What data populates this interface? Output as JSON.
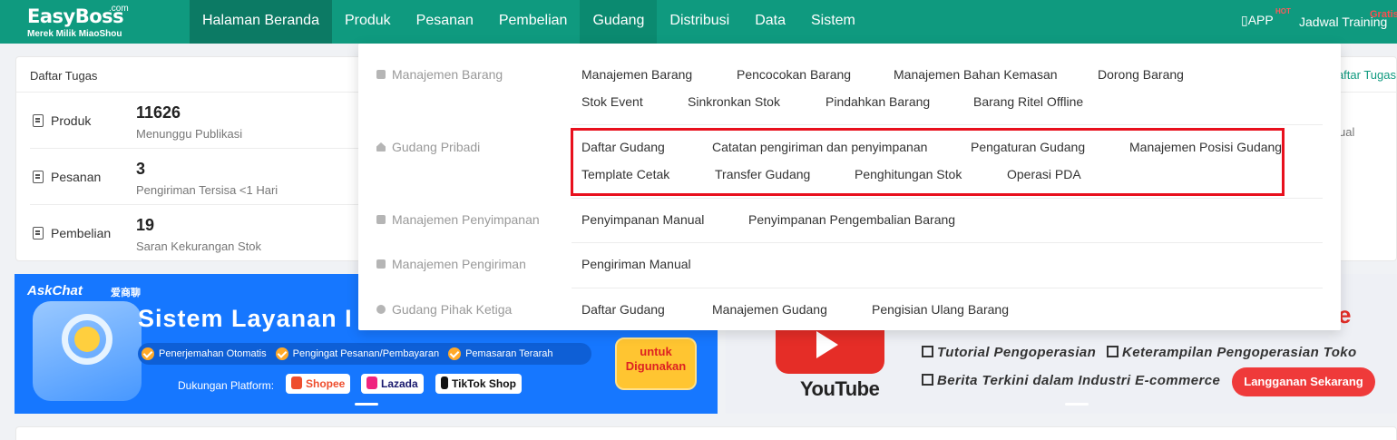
{
  "header": {
    "logo_name": "EasyBoss",
    "logo_com": ".com",
    "logo_tagline": "Merek Milik MiaoShou",
    "nav": [
      "Halaman Beranda",
      "Produk",
      "Pesanan",
      "Pembelian",
      "Gudang",
      "Distribusi",
      "Data",
      "Sistem"
    ],
    "active_nav": "Halaman Beranda",
    "open_nav": "Gudang",
    "app_label": "APP",
    "app_badge": "HOT",
    "training_label": "Jadwal Training",
    "training_badge": "Gratis",
    "accent_color": "#0f9a7f"
  },
  "tasks": {
    "title": "Daftar Tugas",
    "link": "Daftar Tugas",
    "rows": [
      {
        "label": "Produk",
        "count": "11626",
        "desc": "Menunggu Publikasi",
        "icon": "document-icon"
      },
      {
        "label": "Pesanan",
        "count": "3",
        "desc": "Pengiriman Tersisa <1 Hari",
        "icon": "clipboard-icon"
      },
      {
        "label": "Pembelian",
        "count": "19",
        "desc": "Saran Kekurangan Stok",
        "icon": "file-icon"
      }
    ],
    "side_text": "ual"
  },
  "banner_left": {
    "brand": "AskChat",
    "brand_cn": "爱商聊",
    "title": "Sistem Layanan I",
    "features": [
      "Penerjemahan Otomatis",
      "Pengingat Pesanan/Pembayaran",
      "Pemasaran Terarah"
    ],
    "platform_label": "Dukungan Platform:",
    "platforms": [
      "Shopee",
      "Lazada",
      "TikTok Shop"
    ],
    "cta_line1": "untuk",
    "cta_line2": "Digunakan"
  },
  "banner_right": {
    "red_title": "e",
    "logo_text": "YouTube",
    "lines": [
      "Tutorial Pengoperasian",
      "Keterampilan Pengoperasian Toko",
      "Berita Terkini dalam Industri E-commerce"
    ],
    "cta": "Langganan Sekarang"
  },
  "dropdown": {
    "sections": [
      {
        "title": "Manajemen Barang",
        "icon": "box-icon",
        "links": [
          "Manajemen Barang",
          "Pencocokan Barang",
          "Manajemen Bahan Kemasan",
          "Dorong Barang",
          "Stok Event",
          "Sinkronkan Stok",
          "Pindahkan Barang",
          "Barang Ritel Offline"
        ]
      },
      {
        "title": "Gudang Pribadi",
        "icon": "house-icon",
        "links": [
          "Daftar Gudang",
          "Catatan pengiriman dan penyimpanan",
          "Pengaturan Gudang",
          "Manajemen Posisi Gudang",
          "Template Cetak",
          "Transfer Gudang",
          "Penghitungan Stok",
          "Operasi PDA"
        ]
      },
      {
        "title": "Manajemen Penyimpanan",
        "icon": "inbox-icon",
        "links": [
          "Penyimpanan Manual",
          "Penyimpanan Pengembalian Barang"
        ]
      },
      {
        "title": "Manajemen Pengiriman",
        "icon": "truck-icon",
        "links": [
          "Pengiriman Manual"
        ]
      },
      {
        "title": "Gudang Pihak Ketiga",
        "icon": "globe-icon",
        "links": [
          "Daftar Gudang",
          "Manajemen Gudang",
          "Pengisian Ulang Barang"
        ]
      }
    ]
  }
}
